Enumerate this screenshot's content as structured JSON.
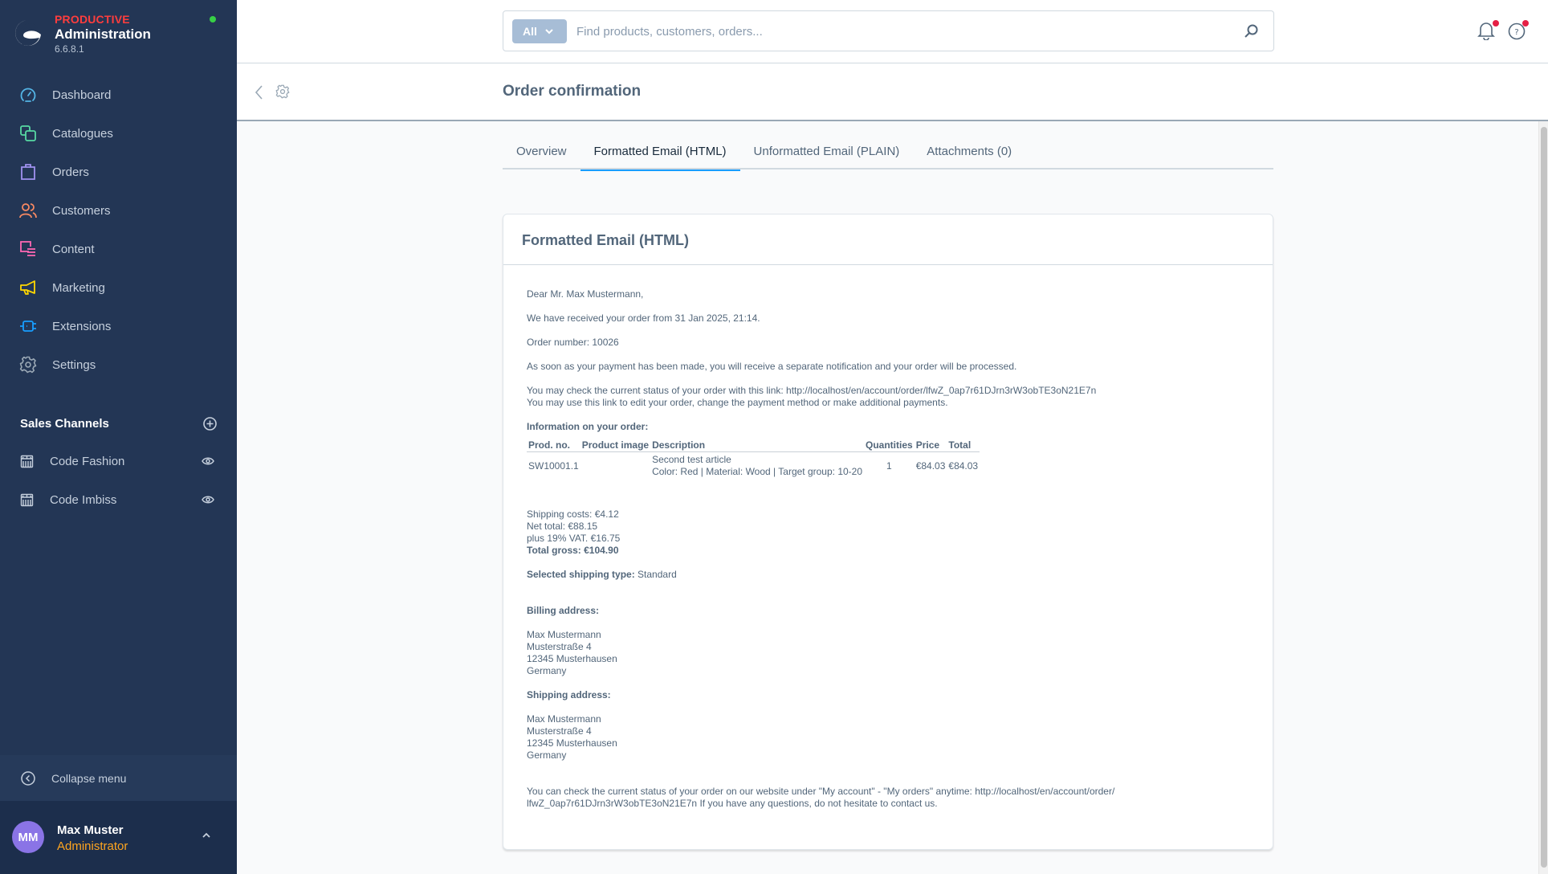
{
  "brand": {
    "environment": "PRODUCTIVE",
    "title": "Administration",
    "version": "6.6.8.1",
    "status_color": "#37d046"
  },
  "sidebar": {
    "items": [
      {
        "label": "Dashboard",
        "icon": "dashboard-icon",
        "color": "#54b5e6"
      },
      {
        "label": "Catalogues",
        "icon": "catalogues-icon",
        "color": "#57d9a3"
      },
      {
        "label": "Orders",
        "icon": "orders-icon",
        "color": "#a092f0"
      },
      {
        "label": "Customers",
        "icon": "customers-icon",
        "color": "#f88962"
      },
      {
        "label": "Content",
        "icon": "content-icon",
        "color": "#ff68b4"
      },
      {
        "label": "Marketing",
        "icon": "marketing-icon",
        "color": "#ffd700"
      },
      {
        "label": "Extensions",
        "icon": "extensions-icon",
        "color": "#189eff"
      },
      {
        "label": "Settings",
        "icon": "settings-icon",
        "color": "#9aa8b5"
      }
    ],
    "sales_channels": {
      "title": "Sales Channels",
      "items": [
        {
          "label": "Code Fashion"
        },
        {
          "label": "Code Imbiss"
        }
      ]
    },
    "collapse_label": "Collapse menu",
    "user": {
      "initials": "MM",
      "name": "Max Muster",
      "role": "Administrator"
    }
  },
  "header": {
    "search": {
      "type_label": "All",
      "placeholder": "Find products, customers, orders...",
      "value": ""
    }
  },
  "smartbar": {
    "title": "Order confirmation"
  },
  "tabs": [
    {
      "label": "Overview",
      "active": false
    },
    {
      "label": "Formatted Email (HTML)",
      "active": true
    },
    {
      "label": "Unformatted Email (PLAIN)",
      "active": false
    },
    {
      "label": "Attachments (0)",
      "active": false
    }
  ],
  "card": {
    "title": "Formatted Email (HTML)",
    "email": {
      "greeting": "Dear Mr. Max Mustermann,",
      "received": "We have received your order from 31 Jan 2025, 21:14.",
      "order_number": "Order number: 10026",
      "payment_note": "As soon as your payment has been made, you will receive a separate notification and your order will be processed.",
      "status_link_line": "You may check the current status of your order with this link: http://localhost/en/account/order/lfwZ_0ap7r61DJrn3rW3obTE3oN21E7n",
      "edit_link_line": "You may use this link to edit your order, change the payment method or make additional payments.",
      "info_heading": "Information on your order:",
      "table": {
        "headers": [
          "Prod. no.",
          "Product image",
          "Description",
          "Quantities",
          "Price",
          "Total"
        ],
        "rows": [
          {
            "prod_no": "SW10001.1",
            "image": "",
            "description": "Second test article",
            "options": "Color: Red | Material: Wood | Target group: 10-20",
            "quantity": "1",
            "price": "€84.03",
            "total": "€84.03"
          }
        ]
      },
      "shipping_costs": "Shipping costs: €4.12",
      "net_total": "Net total: €88.15",
      "vat": "plus 19% VAT. €16.75",
      "total_gross": "Total gross: €104.90",
      "shipping_type_label": "Selected shipping type:",
      "shipping_type_value": "Standard",
      "billing_heading": "Billing address:",
      "billing_address": [
        "Max Mustermann",
        "Musterstraße 4",
        "12345 Musterhausen",
        "Germany"
      ],
      "shipping_heading": "Shipping address:",
      "shipping_address": [
        "Max Mustermann",
        "Musterstraße 4",
        "12345 Musterhausen",
        "Germany"
      ],
      "footer_line1": "You can check the current status of your order on our website under \"My account\" - \"My orders\" anytime: http://localhost/en/account/order/",
      "footer_line2": "lfwZ_0ap7r61DJrn3rW3obTE3oN21E7n If you have any questions, do not hesitate to contact us."
    }
  }
}
